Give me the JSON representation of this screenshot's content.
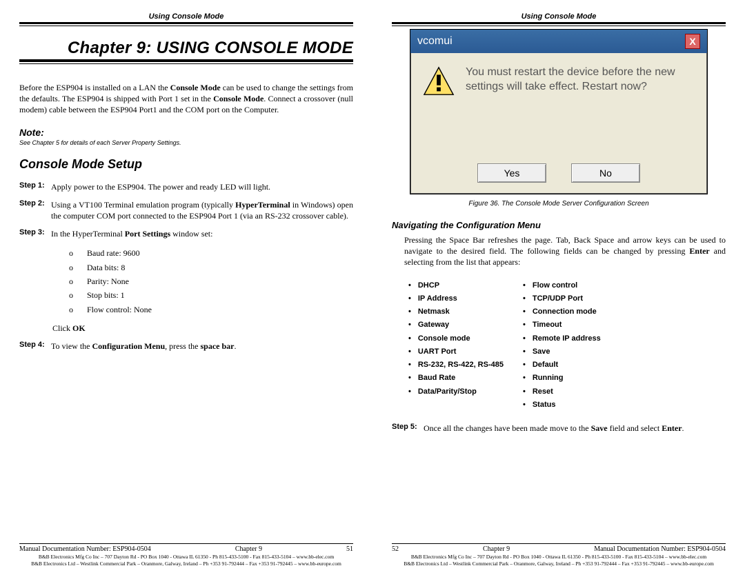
{
  "left": {
    "header_label": "Using Console Mode",
    "chapter_title": "Chapter 9: USING CONSOLE MODE",
    "intro_html": "Before the ESP904 is installed on a LAN the <b>Console Mode</b> can be used to change the settings from the defaults. The ESP904 is shipped with Port 1 set in the <b>Console Mode</b>. Connect a crossover (null modem) cable between the ESP904 Port1 and the COM port on the Computer.",
    "note_head": "Note:",
    "note_text": "See Chapter 5 for details of each Server Property Settings.",
    "section_h": "Console Mode Setup",
    "step1_label": "Step 1:",
    "step1_text": "Apply power to the ESP904. The power and ready LED will light.",
    "step2_label": "Step 2:",
    "step2_html": "Using a VT100 Terminal emulation program (typically <b>HyperTerminal</b> in Windows) open the computer COM port connected to the ESP904 Port 1 (via an RS-232 crossover cable).",
    "step3_label": "Step 3:",
    "step3_html": "In the HyperTerminal <b>Port Settings</b> window set:",
    "sub_items": [
      "Baud rate: 9600",
      "Data bits: 8",
      "Parity: None",
      "Stop bits: 1",
      "Flow control: None"
    ],
    "click_ok_html": "Click <b>OK</b>",
    "step4_label": "Step 4:",
    "step4_html": "To view the <b>Configuration Menu</b>, press the <b>space bar</b>.",
    "footer_left": "Manual Documentation Number: ESP904-0504",
    "footer_mid": "Chapter 9",
    "footer_right": "51",
    "footer_co1": "B&B Electronics Mfg Co Inc – 707 Dayton Rd - PO Box 1040 - Ottawa IL 61350 - Ph 815-433-5100 - Fax 815-433-5104 – www.bb-elec.com",
    "footer_co2": "B&B Electronics Ltd – Westlink Commercial Park – Oranmore, Galway, Ireland – Ph +353 91-792444 – Fax +353 91-792445 – www.bb-europe.com"
  },
  "right": {
    "header_label": "Using Console Mode",
    "dlg_title": "vcomui",
    "dlg_msg": "You must restart the device before the new settings will take effect. Restart now?",
    "btn_yes": "Yes",
    "btn_no": "No",
    "caption": "Figure 36. The Console Mode Server Configuration Screen",
    "sub_h": "Navigating the Configuration Menu",
    "nav_html": "Pressing the Space Bar refreshes the page. Tab, Back Space and arrow keys can be used to navigate to the desired field. The following fields can be changed by pressing <b>Enter</b> and selecting from the list that appears:",
    "col1": [
      "DHCP",
      "IP Address",
      "Netmask",
      "Gateway",
      "Console mode",
      "UART Port",
      "RS-232, RS-422, RS-485",
      "Baud Rate",
      "Data/Parity/Stop"
    ],
    "col2": [
      "Flow control",
      "TCP/UDP Port",
      "Connection mode",
      "Timeout",
      "Remote IP address",
      "Save",
      "Default",
      "Running",
      "Reset",
      "Status"
    ],
    "step5_label": "Step 5:",
    "step5_html": "Once all the changes have been made move to the <b>Save</b> field and select <b>Enter</b>.",
    "footer_left": "52",
    "footer_mid": "Chapter 9",
    "footer_right": "Manual Documentation Number: ESP904-0504",
    "footer_co1": "B&B Electronics Mfg Co Inc – 707 Dayton Rd - PO Box 1040 - Ottawa IL 61350 - Ph 815-433-5100 - Fax 815-433-5104 – www.bb-elec.com",
    "footer_co2": "B&B Electronics Ltd – Westlink Commercial Park – Oranmore, Galway, Ireland – Ph +353 91-792444 – Fax +353 91-792445 – www.bb-europe.com"
  }
}
